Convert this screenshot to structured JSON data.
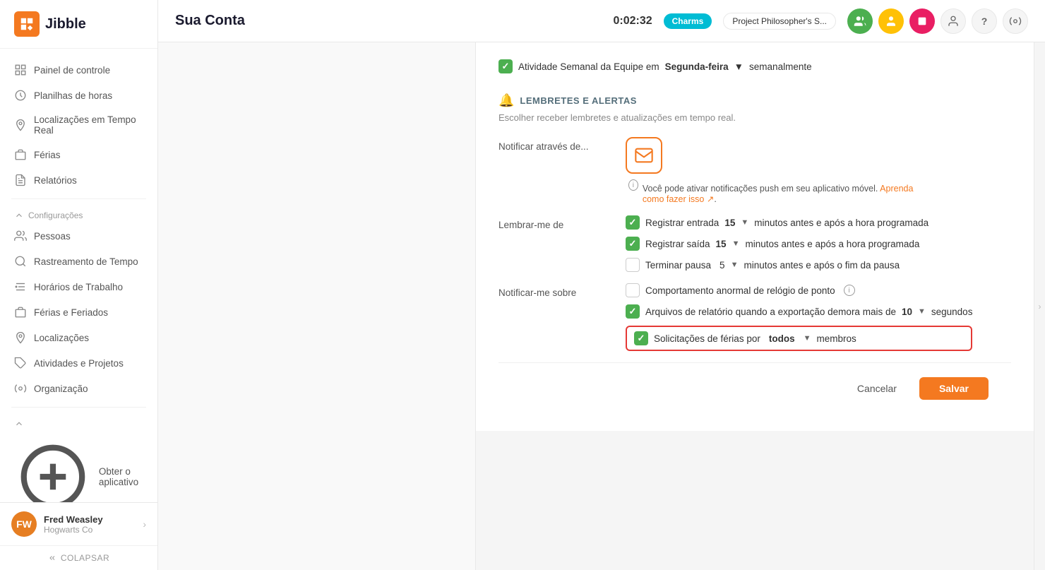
{
  "logo": {
    "text": "Jibble"
  },
  "sidebar": {
    "nav_items": [
      {
        "id": "painel",
        "label": "Painel de controle",
        "icon": "grid"
      },
      {
        "id": "planilhas",
        "label": "Planilhas de horas",
        "icon": "clock"
      },
      {
        "id": "localizacoes-rt",
        "label": "Localizações em Tempo Real",
        "icon": "location"
      },
      {
        "id": "ferias",
        "label": "Férias",
        "icon": "briefcase"
      },
      {
        "id": "relatorios",
        "label": "Relatórios",
        "icon": "file"
      }
    ],
    "config_section": "Configurações",
    "config_items": [
      {
        "id": "pessoas",
        "label": "Pessoas",
        "icon": "people"
      },
      {
        "id": "rastreamento",
        "label": "Rastreamento de Tempo",
        "icon": "search"
      },
      {
        "id": "horarios",
        "label": "Horários de Trabalho",
        "icon": "sliders"
      },
      {
        "id": "ferias-feriados",
        "label": "Férias e Feriados",
        "icon": "briefcase2"
      },
      {
        "id": "localizacoes2",
        "label": "Localizações",
        "icon": "pin"
      },
      {
        "id": "atividades",
        "label": "Atividades e Projetos",
        "icon": "tag"
      },
      {
        "id": "organizacao",
        "label": "Organização",
        "icon": "gear"
      }
    ],
    "get_app": "Obter o aplicativo",
    "user": {
      "name": "Fred Weasley",
      "org": "Hogwarts Co"
    },
    "collapse": "COLAPSAR"
  },
  "topbar": {
    "title": "Sua Conta",
    "timer": "0:02:32",
    "charms_badge": "Charms",
    "project_name": "Project Philosopher's S...",
    "icons": {
      "team": "👥",
      "user_color": "#ffc107",
      "stop": "⏹",
      "profile": "👤",
      "help": "?",
      "settings": "⚙"
    }
  },
  "content": {
    "activity_row": {
      "label": "Atividade Semanal da Equipe em",
      "bold": "Segunda-feira",
      "frequency": "semanalmente"
    },
    "reminders_section": {
      "title": "LEMBRETES E ALERTAS",
      "desc": "Escolher receber lembretes e atualizações em tempo real.",
      "notify_label": "Notificar através de...",
      "email_selected": true,
      "push_info": "Você pode ativar notificações push em seu aplicativo móvel.",
      "push_link": "Aprenda como fazer isso ↗",
      "remember_label": "Lembrar-me de",
      "reminders": [
        {
          "id": "entrada",
          "checked": true,
          "text_before": "Registrar entrada",
          "number": "15",
          "text_after": "minutos antes e após a hora programada"
        },
        {
          "id": "saida",
          "checked": true,
          "text_before": "Registrar saída",
          "number": "15",
          "text_after": "minutos antes e após a hora programada"
        },
        {
          "id": "pausa",
          "checked": false,
          "text_before": "Terminar pausa",
          "number": "5",
          "text_after": "minutos antes e após o fim da pausa"
        }
      ],
      "notify_about_label": "Notificar-me sobre",
      "notify_items": [
        {
          "id": "comportamento",
          "checked": false,
          "text": "Comportamento anormal de relógio de ponto",
          "has_info": true,
          "highlighted": false
        },
        {
          "id": "arquivos",
          "checked": true,
          "text_before": "Arquivos de relatório quando a exportação demora mais de",
          "number": "10",
          "text_after": "segundos",
          "highlighted": false
        },
        {
          "id": "ferias-sol",
          "checked": true,
          "text_before": "Solicitações de férias por",
          "bold": "todos",
          "text_after": "membros",
          "highlighted": true
        }
      ]
    },
    "footer": {
      "cancel": "Cancelar",
      "save": "Salvar"
    }
  }
}
